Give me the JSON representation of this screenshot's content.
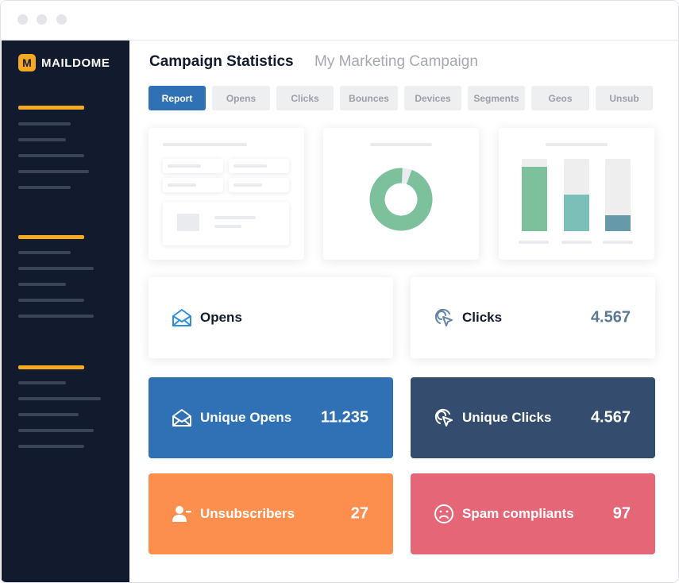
{
  "app": {
    "logo_letter": "M",
    "logo_text": "MAILDOME"
  },
  "header": {
    "title": "Campaign Statistics",
    "subtitle": "My Marketing Campaign"
  },
  "tabs": [
    {
      "label": "Report",
      "active": true
    },
    {
      "label": "Opens",
      "active": false
    },
    {
      "label": "Clicks",
      "active": false
    },
    {
      "label": "Bounces",
      "active": false
    },
    {
      "label": "Devices",
      "active": false
    },
    {
      "label": "Segments",
      "active": false
    },
    {
      "label": "Geos",
      "active": false
    },
    {
      "label": "Unsub",
      "active": false
    }
  ],
  "stats": {
    "opens": {
      "label": "Opens",
      "value": "",
      "icon": "envelope-open-icon"
    },
    "clicks": {
      "label": "Clicks",
      "value": "4.567",
      "icon": "cursor-click-icon"
    },
    "unique_opens": {
      "label": "Unique Opens",
      "value": "11.235",
      "icon": "envelope-open-icon",
      "color": "#2f71b4"
    },
    "unique_clicks": {
      "label": "Unique Clicks",
      "value": "4.567",
      "icon": "cursor-click-icon",
      "color": "#344d6e"
    },
    "unsubscribers": {
      "label": "Unsubscribers",
      "value": "27",
      "icon": "user-remove-icon",
      "color": "#fc8f4d"
    },
    "spam": {
      "label": "Spam compliants",
      "value": "97",
      "icon": "sad-face-icon",
      "color": "#e56677"
    }
  },
  "colors": {
    "sidebar": "#121a2d",
    "accent": "#f7a823",
    "active_tab": "#2f71b4",
    "green": "#7cc19c",
    "teal": "#7cbfb8",
    "slate": "#6699aa"
  },
  "donut_chart": {
    "filled_fraction": 0.95
  },
  "bar_chart": {
    "levels": [
      0.89,
      0.5,
      0.22
    ]
  }
}
